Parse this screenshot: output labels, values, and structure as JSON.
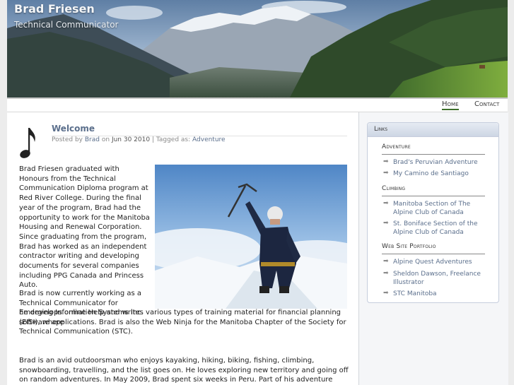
{
  "site": {
    "title": "Brad Friesen",
    "tagline": "Technical Communicator"
  },
  "nav": {
    "home": "Home",
    "contact": "Contact"
  },
  "post": {
    "title": "Welcome",
    "meta_posted_by": "Posted by",
    "meta_author": "Brad",
    "meta_on": "on",
    "meta_date": "Jun 30 2010",
    "meta_tagged": "| Tagged as:",
    "meta_tag": "Adventure",
    "p1": "Brad Friesen graduated with Honours from the Technical Communication Diploma program at Red River College. During the final year of the program, Brad had the opportunity to work for the Manitoba Housing and Renewal Corporation. Since graduating from the program, Brad has worked as an independent contractor writing and developing documents for several companies including PPG Canada and Princess Auto.",
    "p2a": "Brad is now currently working as a Technical Communicator for Emerging Information Systems Inc. (EISI), where",
    "p2b": "he develops online Help and writes various types of training material for financial planning software applications. Brad is also the Web Ninja for the Manitoba Chapter of the Society for Technical Communication (STC).",
    "p3": "Brad is an avid outdoorsman who enjoys kayaking, hiking, biking, fishing, climbing, snowboarding, travelling, and the list goes on. He loves exploring new territory and going off on random adventures. In May 2009, Brad spent six weeks in Peru. Part of his adventure included trekking the Inca Trail to Machu"
  },
  "sidebar": {
    "title": "Links",
    "sections": [
      {
        "heading": "Adventure",
        "items": [
          "Brad's Peruvian Adventure",
          "My Camino de Santiago"
        ]
      },
      {
        "heading": "Climbing",
        "items": [
          "Manitoba Section of The Alpine Club of Canada",
          "St. Boniface Section of the Alpine Club of Canada"
        ]
      },
      {
        "heading": "Web Site Portfolio",
        "items": [
          "Alpine Quest Adventures",
          "Sheldon Dawson, Freelance Illustrator",
          "STC Manitoba"
        ]
      }
    ]
  },
  "icons": {
    "post_icon": "music-note-icon",
    "link_bullet": "arrow-right-icon"
  },
  "colors": {
    "link": "#5b6f8c",
    "nav_active": "#3d6f2a"
  }
}
